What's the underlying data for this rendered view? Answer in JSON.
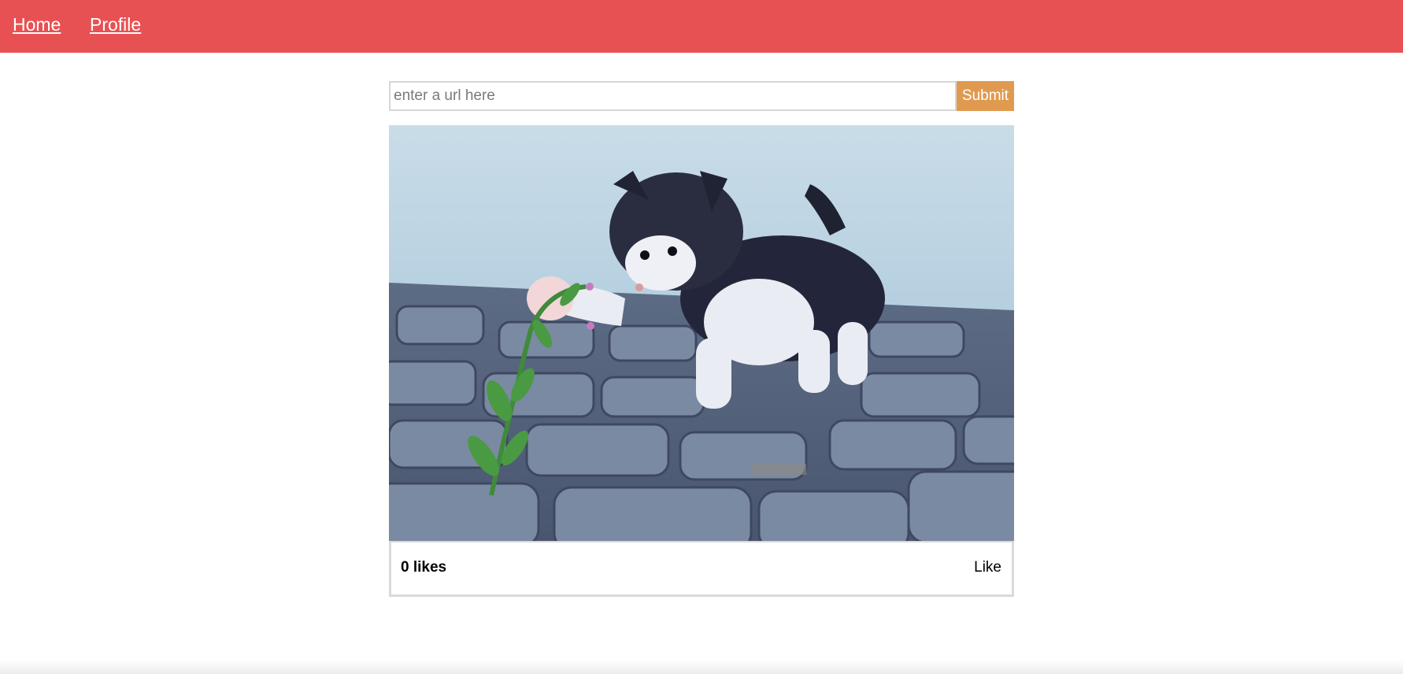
{
  "nav": {
    "home_label": "Home",
    "profile_label": "Profile",
    "brand_color": "#e85153"
  },
  "url_form": {
    "placeholder": "enter a url here",
    "value": "",
    "submit_label": "Submit",
    "submit_color": "#e09a4f"
  },
  "post": {
    "image_subject": "kitten-photo",
    "likes_text": "0 likes",
    "like_label": "Like"
  }
}
